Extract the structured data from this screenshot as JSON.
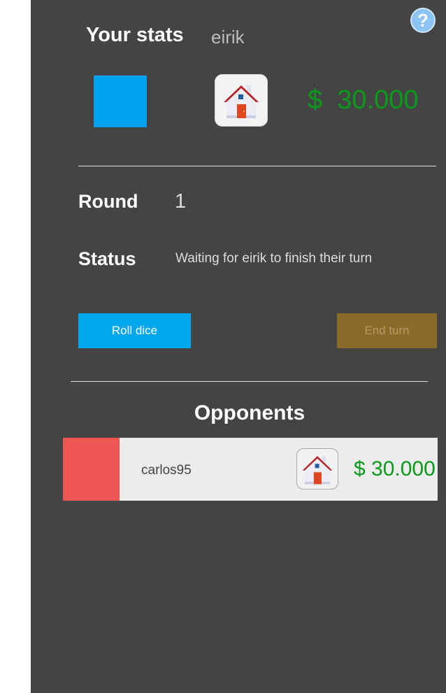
{
  "help": {
    "label": "?"
  },
  "stats": {
    "title": "Your stats",
    "username": "eirik",
    "money": "$  30.000",
    "player_color": "#00a2f0",
    "property_icon": "house-icon"
  },
  "round": {
    "label": "Round",
    "value": "1"
  },
  "status": {
    "label": "Status",
    "value": "Waiting for eirik to finish their turn"
  },
  "actions": {
    "roll_label": "Roll dice",
    "end_label": "End turn"
  },
  "opponents": {
    "title": "Opponents",
    "items": [
      {
        "name": "carlos95",
        "money": "$ 30.000",
        "color": "#ee5653",
        "property_icon": "house-icon"
      }
    ]
  }
}
